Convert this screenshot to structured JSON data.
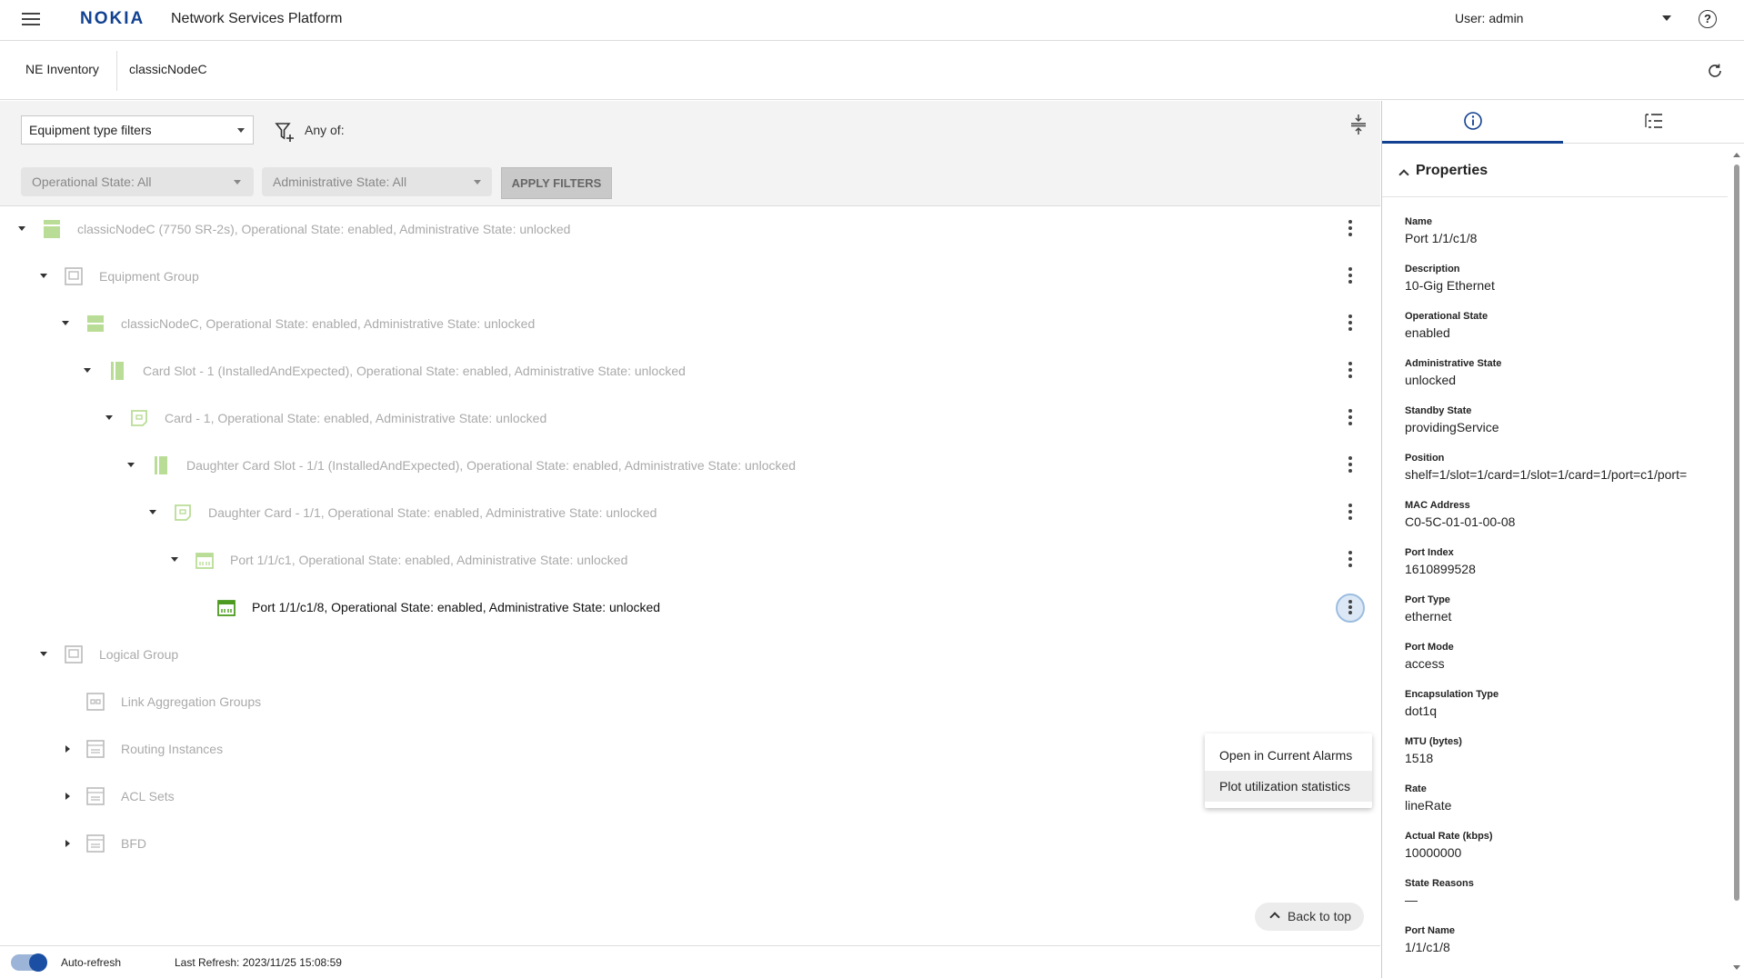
{
  "header": {
    "logo_text": "NOKIA",
    "app_title": "Network Services Platform",
    "user_label": "User: admin",
    "help_glyph": "?"
  },
  "breadcrumb": {
    "item1": "NE Inventory",
    "item2": "classicNodeC"
  },
  "filters": {
    "equipment_filter": "Equipment type filters",
    "any_of": "Any of:",
    "operational_state": "Operational State:  All",
    "administrative_state": "Administrative State:  All",
    "apply_label": "APPLY FILTERS"
  },
  "tree": [
    {
      "label": "classicNodeC (7750 SR-2s), Operational State: enabled, Administrative State: unlocked"
    },
    {
      "label": "Equipment Group"
    },
    {
      "label": "classicNodeC, Operational State: enabled, Administrative State: unlocked"
    },
    {
      "label": "Card Slot - 1 (InstalledAndExpected), Operational State: enabled, Administrative State: unlocked"
    },
    {
      "label": "Card - 1, Operational State: enabled, Administrative State: unlocked"
    },
    {
      "label": "Daughter Card Slot - 1/1 (InstalledAndExpected), Operational State: enabled, Administrative State: unlocked"
    },
    {
      "label": "Daughter Card - 1/1, Operational State: enabled, Administrative State: unlocked"
    },
    {
      "label": "Port 1/1/c1, Operational State: enabled, Administrative State: unlocked"
    },
    {
      "label": "Port 1/1/c1/8, Operational State: enabled, Administrative State: unlocked"
    },
    {
      "label": "Logical Group"
    },
    {
      "label": "Link Aggregation Groups"
    },
    {
      "label": "Routing Instances"
    },
    {
      "label": "ACL Sets"
    },
    {
      "label": "BFD"
    }
  ],
  "context_menu": {
    "items": [
      "Open in Current Alarms",
      "Plot utilization statistics"
    ]
  },
  "back_to_top": "Back to top",
  "footer": {
    "auto_refresh": "Auto-refresh",
    "last_refresh": "Last Refresh: 2023/11/25 15:08:59"
  },
  "properties": {
    "title": "Properties",
    "items": [
      {
        "key": "Name",
        "value": "Port 1/1/c1/8"
      },
      {
        "key": "Description",
        "value": "10-Gig Ethernet"
      },
      {
        "key": "Operational State",
        "value": "enabled"
      },
      {
        "key": "Administrative State",
        "value": "unlocked"
      },
      {
        "key": "Standby State",
        "value": "providingService"
      },
      {
        "key": "Position",
        "value": "shelf=1/slot=1/card=1/slot=1/card=1/port=c1/port="
      },
      {
        "key": "MAC Address",
        "value": "C0-5C-01-01-00-08"
      },
      {
        "key": "Port Index",
        "value": "1610899528"
      },
      {
        "key": "Port Type",
        "value": "ethernet"
      },
      {
        "key": "Port Mode",
        "value": "access"
      },
      {
        "key": "Encapsulation Type",
        "value": "dot1q"
      },
      {
        "key": "MTU (bytes)",
        "value": "1518"
      },
      {
        "key": "Rate",
        "value": "lineRate"
      },
      {
        "key": "Actual Rate (kbps)",
        "value": "10000000"
      },
      {
        "key": "State Reasons",
        "value": "—"
      },
      {
        "key": "Port Name",
        "value": "1/1/c1/8"
      }
    ]
  },
  "colors": {
    "brand": "#124191",
    "tree_icon_green": "#7fbf3f",
    "toggle_on": "#1a4fa3"
  }
}
